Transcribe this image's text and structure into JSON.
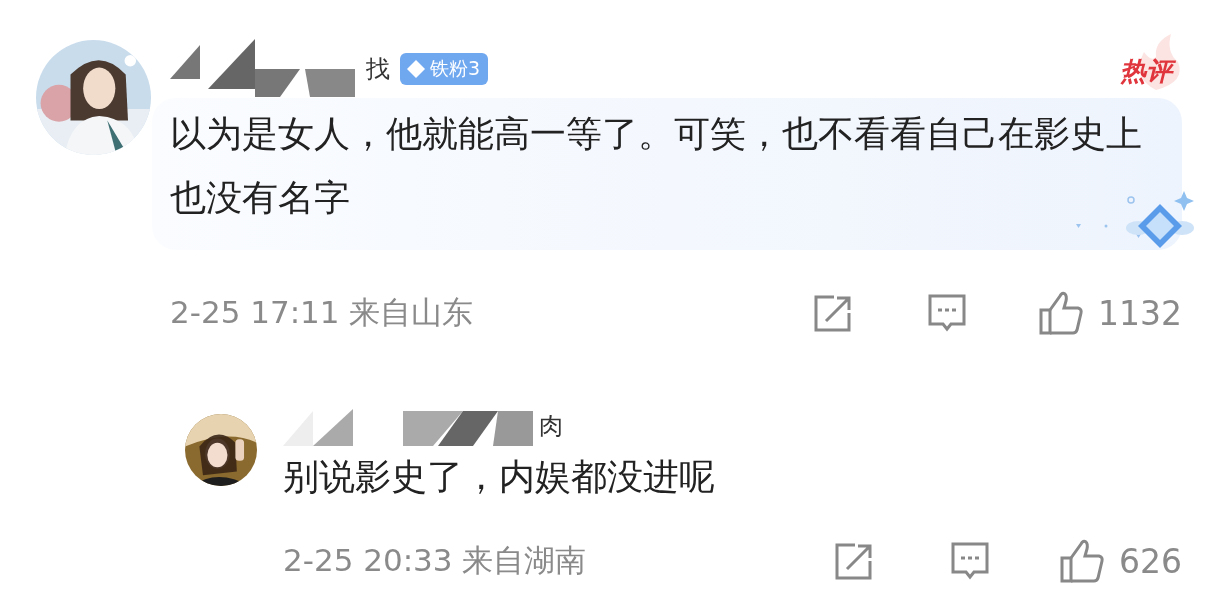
{
  "comments": [
    {
      "kind": "top",
      "username": "找",
      "badge": "铁粉3",
      "hot_label": "热评",
      "text": "以为是女人，他就能高一等了。可笑，也不看看自己在影史上也没有名字",
      "meta": "2-25 17:11 来自山东",
      "likes": "1132"
    },
    {
      "kind": "reply",
      "username": "肉",
      "text": "别说影史了，内娱都没进呢",
      "meta": "2-25 20:33 来自湖南",
      "likes": "626"
    }
  ]
}
